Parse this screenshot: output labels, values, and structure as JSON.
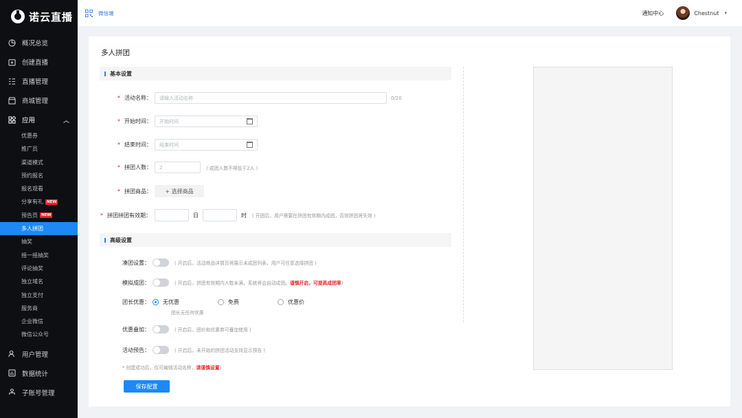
{
  "brand": {
    "name": "诺云直播"
  },
  "sidebar": {
    "items": [
      {
        "label": "概况总览",
        "icon": "pie-chart-icon"
      },
      {
        "label": "创建直播",
        "icon": "tv-add-icon"
      },
      {
        "label": "直播管理",
        "icon": "list-icon"
      },
      {
        "label": "商城管理",
        "icon": "shop-icon"
      },
      {
        "label": "应用",
        "icon": "apps-icon"
      }
    ],
    "sub_items": [
      {
        "label": "优惠券"
      },
      {
        "label": "推广员"
      },
      {
        "label": "渠道模式"
      },
      {
        "label": "预约报名"
      },
      {
        "label": "报名观看"
      },
      {
        "label": "分享有礼",
        "badge": "NEW"
      },
      {
        "label": "预告页",
        "badge": "NEW"
      },
      {
        "label": "多人拼团",
        "active": true
      },
      {
        "label": "抽奖"
      },
      {
        "label": "摇一摇抽奖"
      },
      {
        "label": "评论抽奖"
      },
      {
        "label": "独立域名"
      },
      {
        "label": "独立支付"
      },
      {
        "label": "服务商"
      },
      {
        "label": "企业微信"
      },
      {
        "label": "微信公众号"
      }
    ],
    "bottom_items": [
      {
        "label": "用户管理",
        "icon": "user-icon"
      },
      {
        "label": "数据统计",
        "icon": "stats-icon"
      },
      {
        "label": "子账号管理",
        "icon": "sub-account-icon"
      }
    ]
  },
  "topbar": {
    "tab": "微信端",
    "notify": "通知中心",
    "username": "Chestnut"
  },
  "page": {
    "title": "多人拼团",
    "basic": {
      "heading": "基本设置",
      "name_label": "活动名称：",
      "name_placeholder": "请输入活动名称",
      "name_counter": "0/20",
      "start_label": "开始时间：",
      "start_placeholder": "开始时间",
      "end_label": "结束时间：",
      "end_placeholder": "结束时间",
      "size_label": "拼团人数：",
      "size_value": "2",
      "size_hint": "( 成团人数不得低于2人 )",
      "goods_label": "拼团商品：",
      "goods_button": "+ 选择商品",
      "validity_label": "拼团拼团有效期：",
      "day_unit": "日",
      "hour_unit": "时",
      "validity_hint": "( 开团后，用户需要在拼团有效期内成团，否则拼团将失效 )"
    },
    "advanced": {
      "heading": "高级设置",
      "group_label": "凑团设置：",
      "group_hint": "( 开启后，活动商品详情页将展示未成团列表，用户可任意选择拼团 )",
      "sim_label": "模拟成团：",
      "sim_hint": "( 开启后，拼团有效期内人数未满，系统将会自动成团。",
      "sim_hint_red": "谨慎开启，可提高成团率",
      "sim_hint_end": ")",
      "leader_label": "团长优惠：",
      "leader_options": [
        "无优惠",
        "免费",
        "优惠价"
      ],
      "leader_selected": "无优惠",
      "leader_sub": "团长无任何优惠",
      "stack_label": "优惠叠加：",
      "stack_hint": "( 开启后，团价和优惠券可叠加使用 )",
      "preview_label": "活动预告：",
      "preview_hint": "( 开启后，未开始的拼团活动支持显示预告 )",
      "note": "* 创建成功后，仅可编辑活动名称，",
      "note_red": "请谨慎设置",
      "note_end": ")"
    },
    "save_button": "保存配置"
  },
  "colors": {
    "accent": "#1e88f5",
    "sidebar_bg": "#0e0f12",
    "danger": "#e8252b"
  }
}
